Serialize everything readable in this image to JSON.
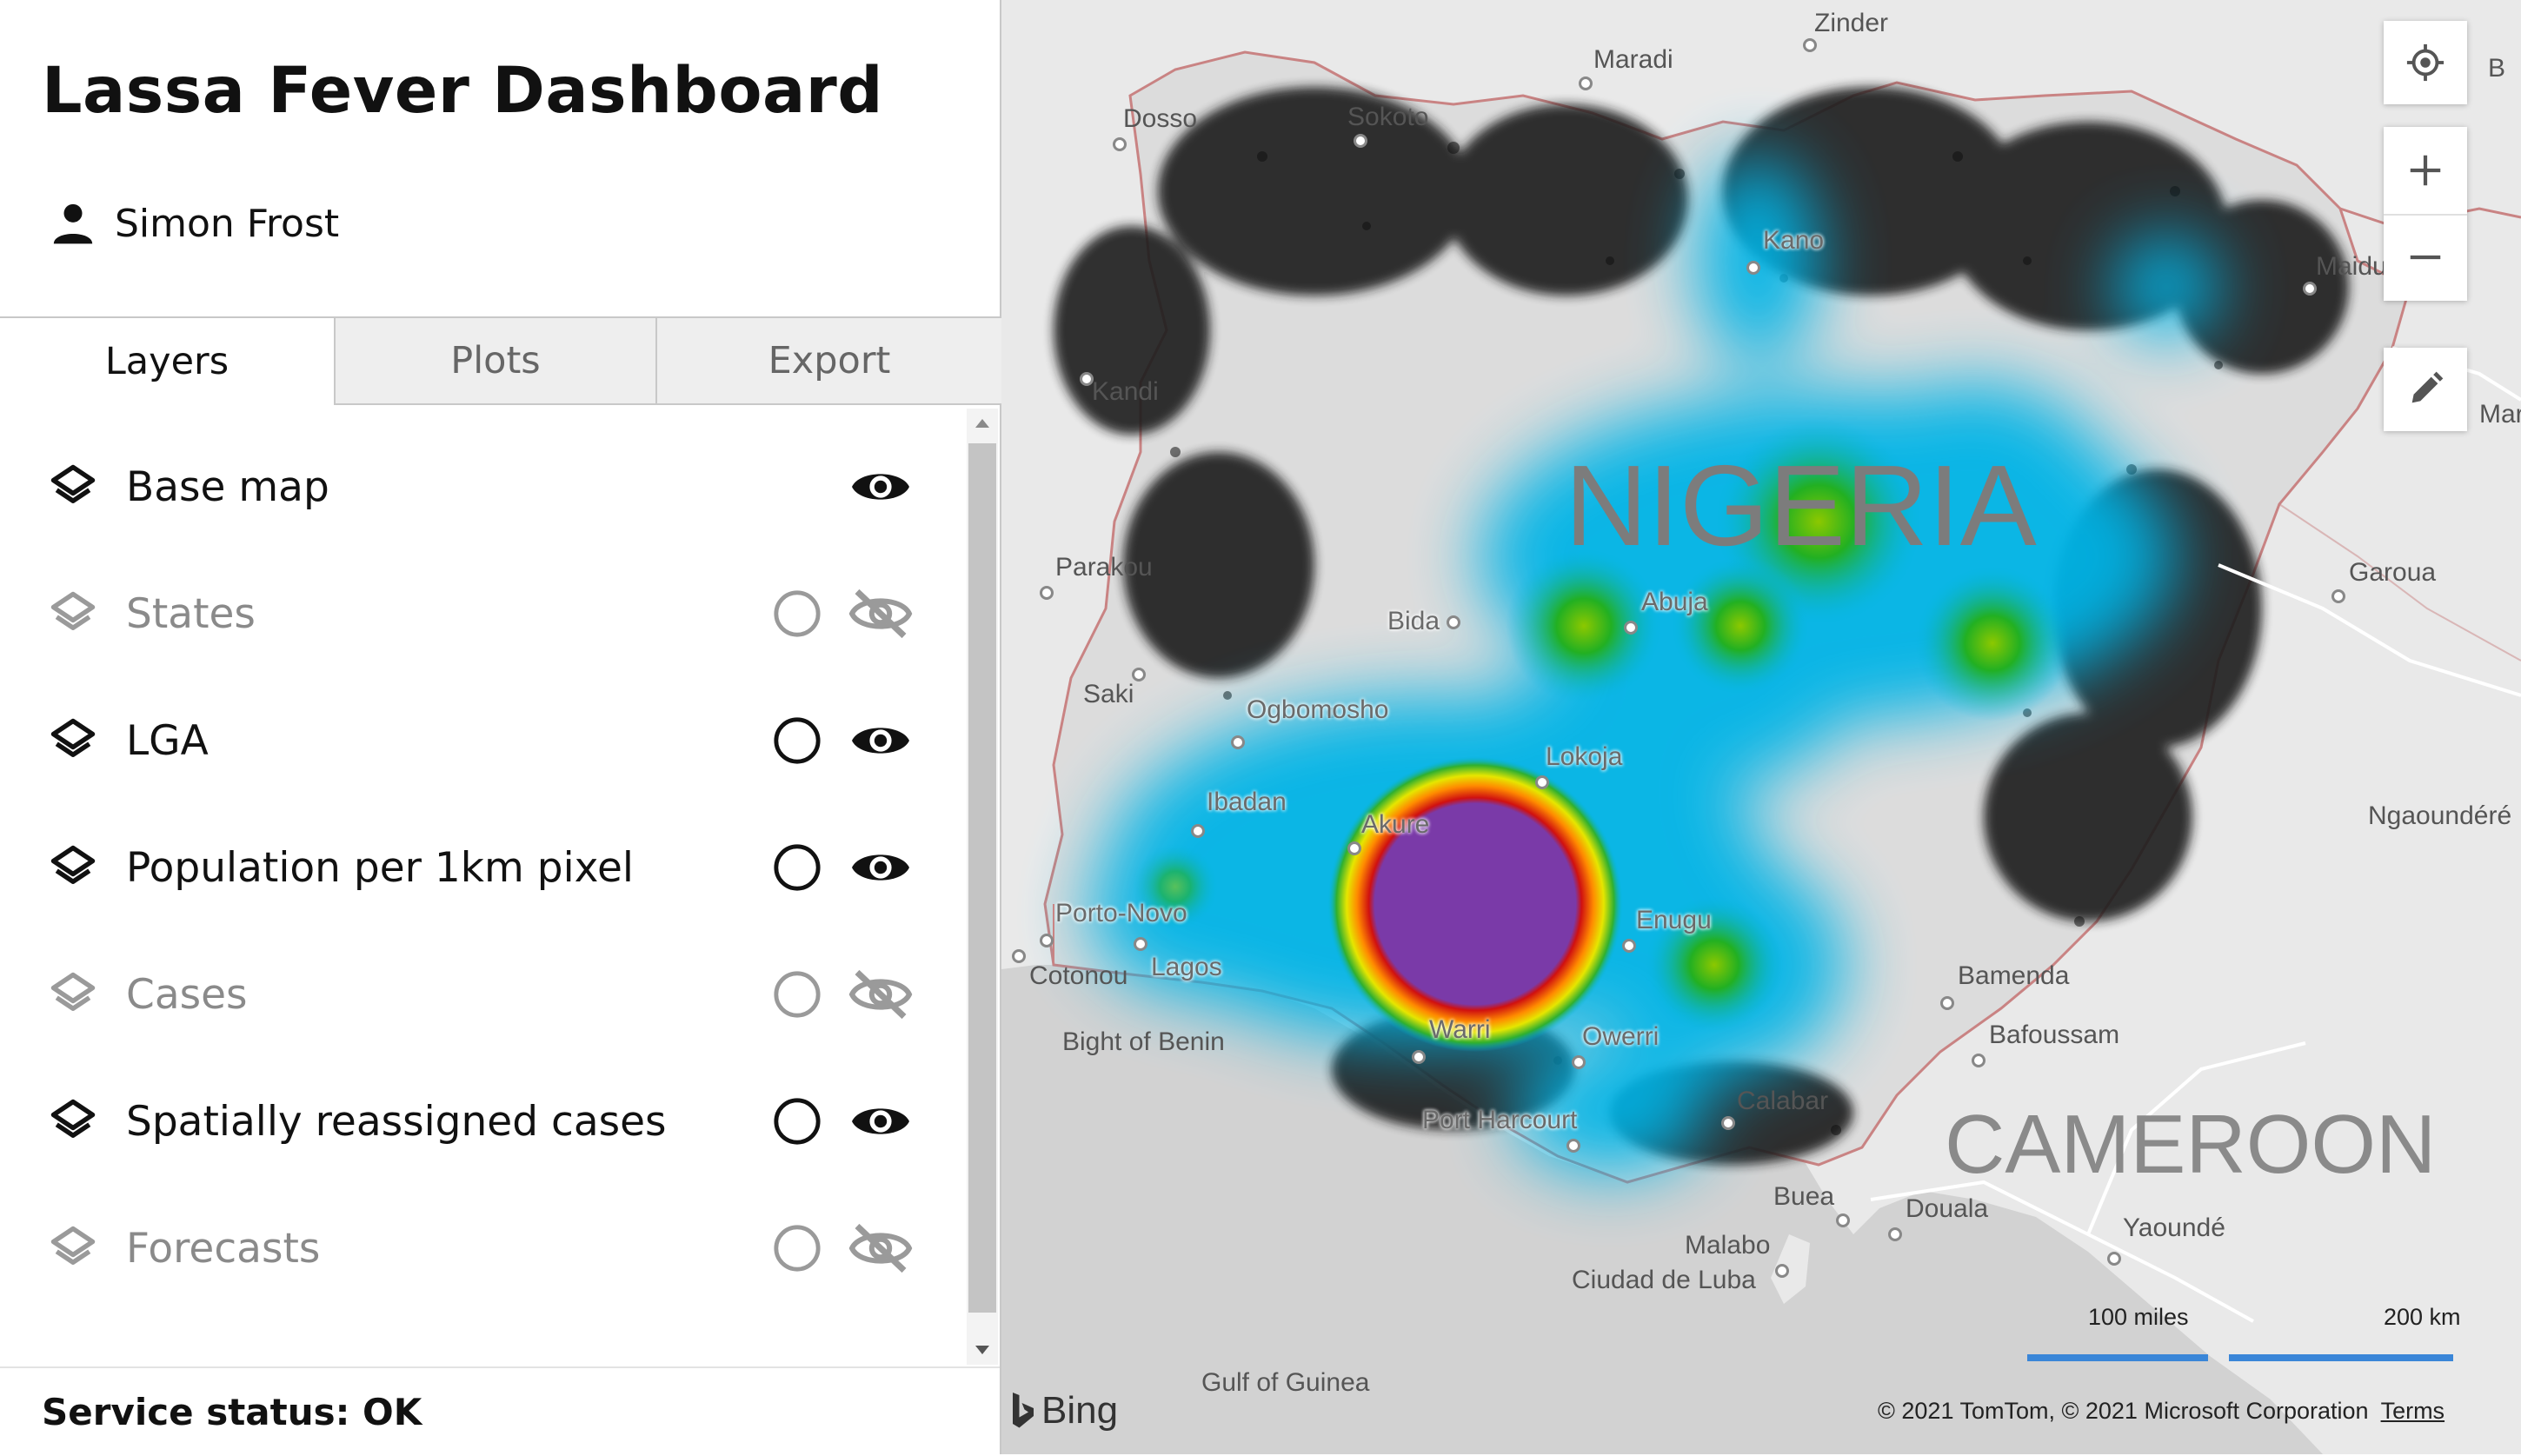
{
  "app": {
    "title": "Lassa Fever Dashboard"
  },
  "user": {
    "name": "Simon Frost",
    "icon": "person-icon"
  },
  "tabs": [
    {
      "label": "Layers",
      "active": true
    },
    {
      "label": "Plots",
      "active": false
    },
    {
      "label": "Export",
      "active": false
    }
  ],
  "layers": [
    {
      "label": "Base map",
      "enabled": true,
      "has_radio": false,
      "visible": true
    },
    {
      "label": "States",
      "enabled": false,
      "has_radio": true,
      "visible": false
    },
    {
      "label": "LGA",
      "enabled": true,
      "has_radio": true,
      "visible": true
    },
    {
      "label": "Population per 1km pixel",
      "enabled": true,
      "has_radio": true,
      "visible": true
    },
    {
      "label": "Cases",
      "enabled": false,
      "has_radio": true,
      "visible": false
    },
    {
      "label": "Spatially reassigned cases",
      "enabled": true,
      "has_radio": true,
      "visible": true
    },
    {
      "label": "Forecasts",
      "enabled": false,
      "has_radio": true,
      "visible": false
    }
  ],
  "status": {
    "text": "Service status: OK"
  },
  "map": {
    "countries": {
      "nigeria": "NIGERIA",
      "cameroon": "CAMEROON"
    },
    "cities": {
      "zinder": "Zinder",
      "maradi": "Maradi",
      "dosso": "Dosso",
      "sokoto": "Sokoto",
      "kano": "Kano",
      "maiduguri": "Maidu",
      "kandi": "Kandi",
      "maroua": "Maro",
      "parakou": "Parakou",
      "bida": "Bida",
      "abuja": "Abuja",
      "garoua": "Garoua",
      "saki": "Saki",
      "ogbomosho": "Ogbomosho",
      "lokoja": "Lokoja",
      "ibadan": "Ibadan",
      "akure": "Akure",
      "ngaoundere": "Ngaoundéré",
      "porto_novo": "Porto-Novo",
      "cotonou": "Cotonou",
      "lagos": "Lagos",
      "enugu": "Enugu",
      "bamenda": "Bamenda",
      "warri": "Warri",
      "owerri": "Owerri",
      "bafoussam": "Bafoussam",
      "bight_of_benin": "Bight of Benin",
      "port_harcourt": "Port Harcourt",
      "calabar": "Calabar",
      "buea": "Buea",
      "douala": "Douala",
      "malabo": "Malabo",
      "ciudad_de_luba": "Ciudad de Luba",
      "yaounde": "Yaoundé",
      "gulf_of_guinea": "Gulf of Guinea",
      "edge_b": "B"
    },
    "scale": {
      "miles": "100 miles",
      "km": "200 km"
    },
    "attribution": "© 2021 TomTom, © 2021 Microsoft Corporation",
    "terms": "Terms",
    "provider": "Bing",
    "controls": [
      "my-location-icon",
      "zoom-in-icon",
      "zoom-out-icon",
      "draw-pencil-icon"
    ],
    "colors": {
      "water": "#d2d2d2",
      "land": "#e9e9e9",
      "border": "#d08a8a",
      "heat_low": "#00b4e6",
      "heat_mid": "#1aa81a",
      "heat_high": "#e01010",
      "heat_peak": "#7a3aa8",
      "scale_bar": "#3a86d8"
    }
  }
}
